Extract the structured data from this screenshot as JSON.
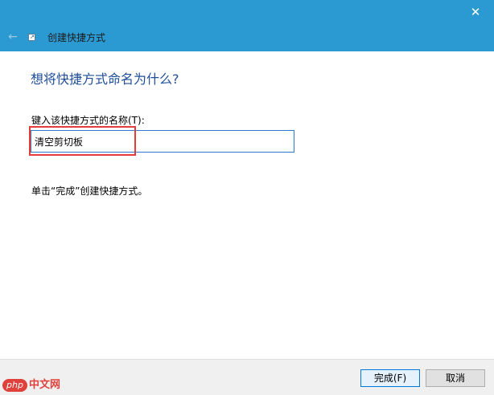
{
  "window": {
    "title": "创建快捷方式",
    "close_glyph": "✕",
    "back_glyph": "←"
  },
  "main": {
    "heading": "想将快捷方式命名为什么?",
    "field_label": "键入该快捷方式的名称(T):",
    "name_value": "清空剪切板",
    "hint": "单击“完成”创建快捷方式。"
  },
  "buttons": {
    "finish": "完成(F)",
    "cancel": "取消"
  },
  "watermark": {
    "badge": "php",
    "text": "中文网"
  },
  "colors": {
    "titlebar": "#2b9ad2",
    "heading": "#1f4e99",
    "highlight": "#e53b3b",
    "input_border": "#2b7bd6"
  },
  "icons": {
    "title_icon": "shortcut-icon",
    "back": "back-arrow-icon",
    "close": "close-icon"
  }
}
